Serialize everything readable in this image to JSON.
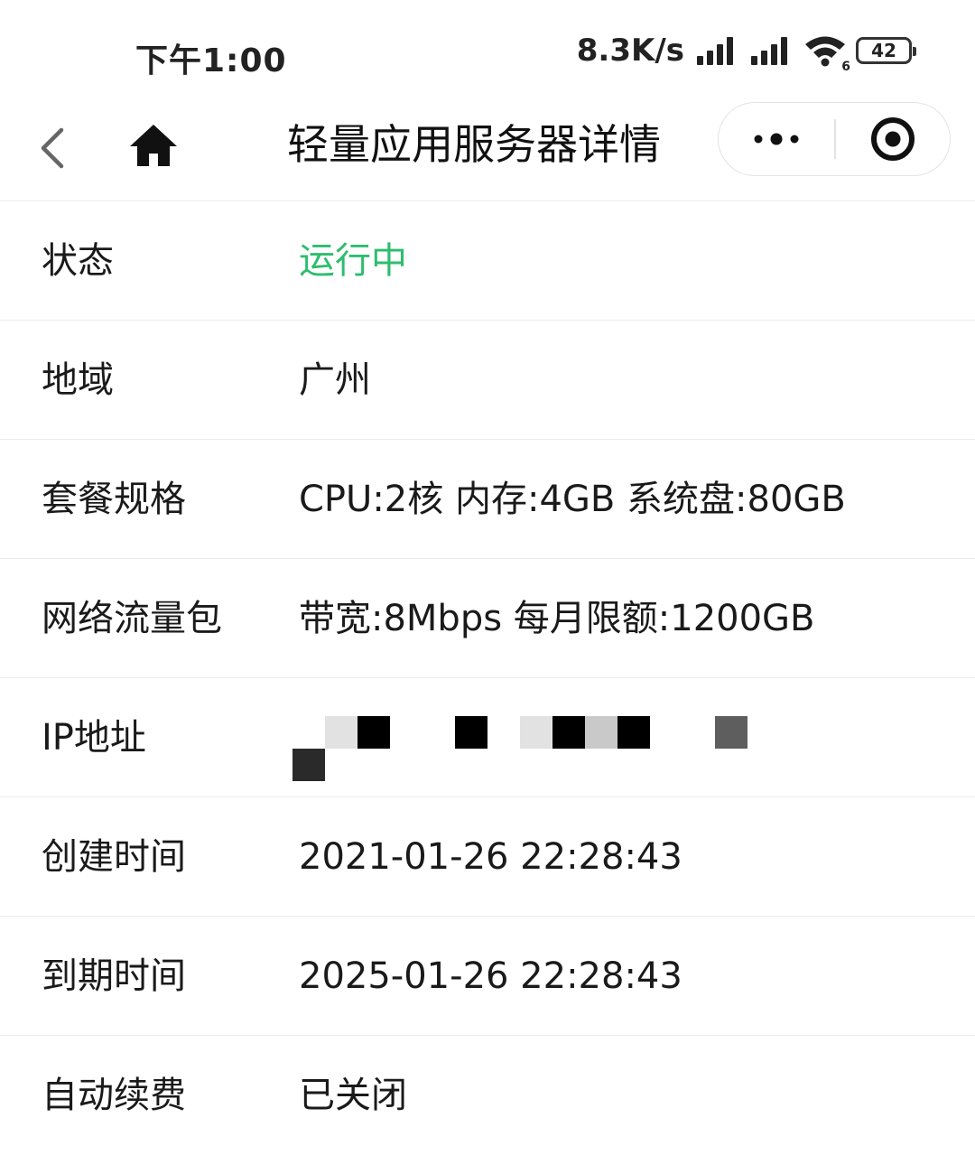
{
  "status_bar": {
    "time": "下午1:00",
    "net_speed": "8.3K/s",
    "wifi_badge": "6",
    "battery": "42"
  },
  "nav": {
    "title": "轻量应用服务器详情",
    "back_icon": "chevron-left-icon",
    "home_icon": "home-icon",
    "more_icon": "more-dots-icon",
    "close_icon": "target-circle-icon"
  },
  "details": {
    "rows": [
      {
        "label": "状态",
        "value": "运行中"
      },
      {
        "label": "地域",
        "value": "广州"
      },
      {
        "label": "套餐规格",
        "value": "CPU:2核 内存:4GB 系统盘:80GB"
      },
      {
        "label": "网络流量包",
        "value": "带宽:8Mbps 每月限额:1200GB"
      },
      {
        "label": "IP地址",
        "value": ""
      },
      {
        "label": "创建时间",
        "value": "2021-01-26 22:28:43"
      },
      {
        "label": "到期时间",
        "value": "2025-01-26 22:28:43"
      },
      {
        "label": "自动续费",
        "value": "已关闭"
      }
    ]
  },
  "colors": {
    "status_running": "#2dbd6e",
    "divider": "#ececec",
    "text": "#1a1a1a"
  }
}
